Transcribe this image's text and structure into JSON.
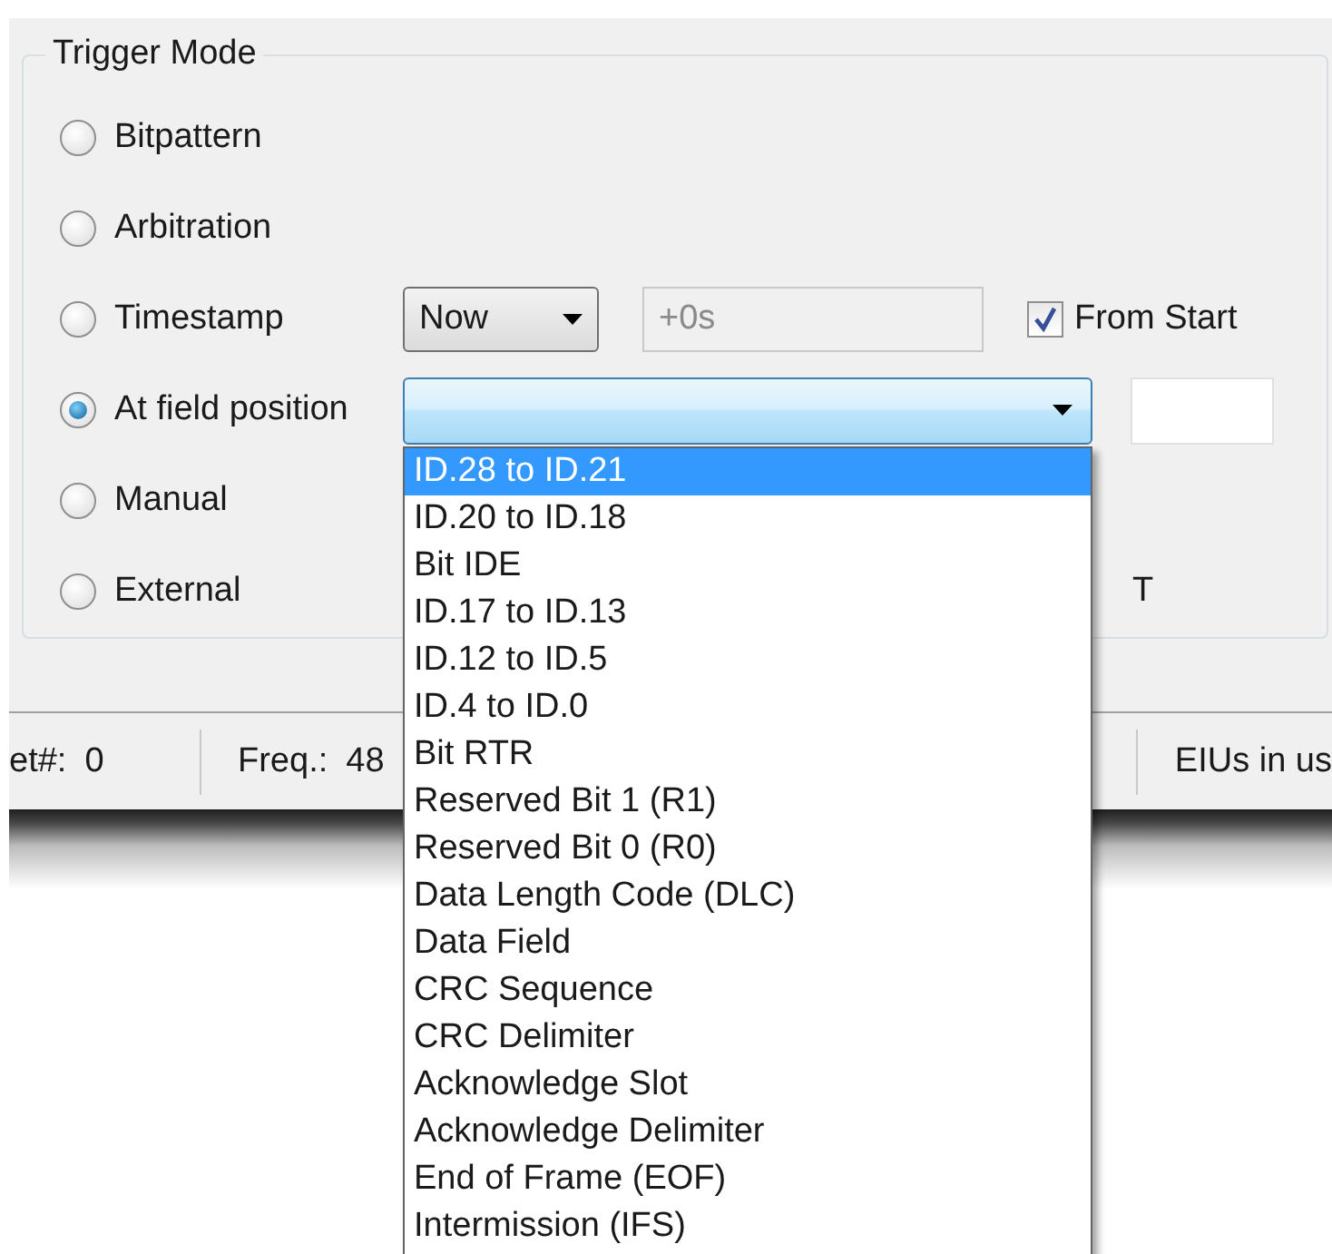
{
  "trigger_mode": {
    "title": "Trigger Mode",
    "options": [
      {
        "label": "Bitpattern",
        "selected": false
      },
      {
        "label": "Arbitration",
        "selected": false
      },
      {
        "label": "Timestamp",
        "selected": false,
        "select": {
          "value": "Now"
        },
        "offset_field": {
          "value": "+0s",
          "disabled": true
        },
        "from_start": {
          "label": "From Start",
          "checked": true
        }
      },
      {
        "label": "At field position",
        "selected": true,
        "combo": {
          "expanded": true
        },
        "position_field": {
          "disabled": false
        }
      },
      {
        "label": "Manual",
        "selected": false
      },
      {
        "label": "External",
        "selected": false,
        "trailing_text": "T"
      }
    ]
  },
  "status_bar": [
    {
      "label": "et#:",
      "value": "0"
    },
    {
      "label": "Freq.:",
      "value": "48"
    },
    {
      "label": "EIUs in us"
    }
  ],
  "dropdown_list": [
    {
      "label": "ID.28 to ID.21",
      "selected": true
    },
    {
      "label": "ID.20 to ID.18",
      "selected": false
    },
    {
      "label": "Bit IDE",
      "selected": false
    },
    {
      "label": "ID.17 to ID.13",
      "selected": false
    },
    {
      "label": "ID.12 to ID.5",
      "selected": false
    },
    {
      "label": "ID.4 to ID.0",
      "selected": false
    },
    {
      "label": "Bit RTR",
      "selected": false
    },
    {
      "label": "Reserved Bit 1 (R1)",
      "selected": false
    },
    {
      "label": "Reserved Bit 0 (R0)",
      "selected": false
    },
    {
      "label": "Data Length Code (DLC)",
      "selected": false
    },
    {
      "label": "Data Field",
      "selected": false
    },
    {
      "label": "CRC Sequence",
      "selected": false
    },
    {
      "label": "CRC Delimiter",
      "selected": false
    },
    {
      "label": "Acknowledge Slot",
      "selected": false
    },
    {
      "label": "Acknowledge Delimiter",
      "selected": false
    },
    {
      "label": "End of Frame (EOF)",
      "selected": false
    },
    {
      "label": "Intermission (IFS)",
      "selected": false
    }
  ]
}
